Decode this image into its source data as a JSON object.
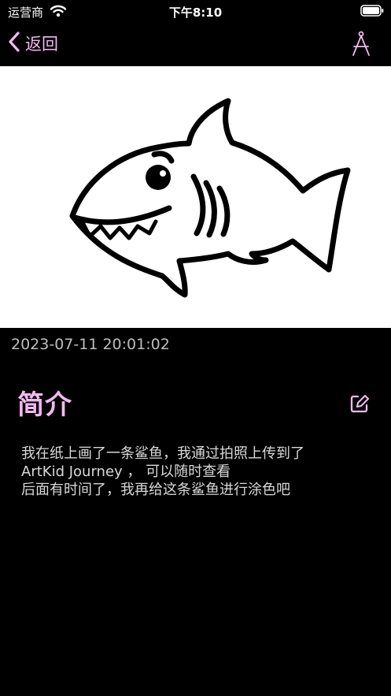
{
  "status_bar": {
    "carrier": "运营商",
    "time": "下午8:10"
  },
  "nav": {
    "back_label": "返回"
  },
  "artwork": {
    "timestamp": "2023-07-11 20:01:02"
  },
  "intro": {
    "title": "简介",
    "lines": [
      "我在纸上画了一条鲨鱼，我通过拍照上传到了",
      "ArtKid Journey ， 可以随时查看",
      "后面有时间了，我再给这条鲨鱼进行涂色吧"
    ]
  },
  "colors": {
    "accent": "#f3b8f1",
    "background": "#000000"
  },
  "icons": {
    "back": "chevron-left-icon",
    "tool": "compass-icon",
    "edit": "edit-icon",
    "wifi": "wifi-icon",
    "battery": "battery-icon"
  }
}
